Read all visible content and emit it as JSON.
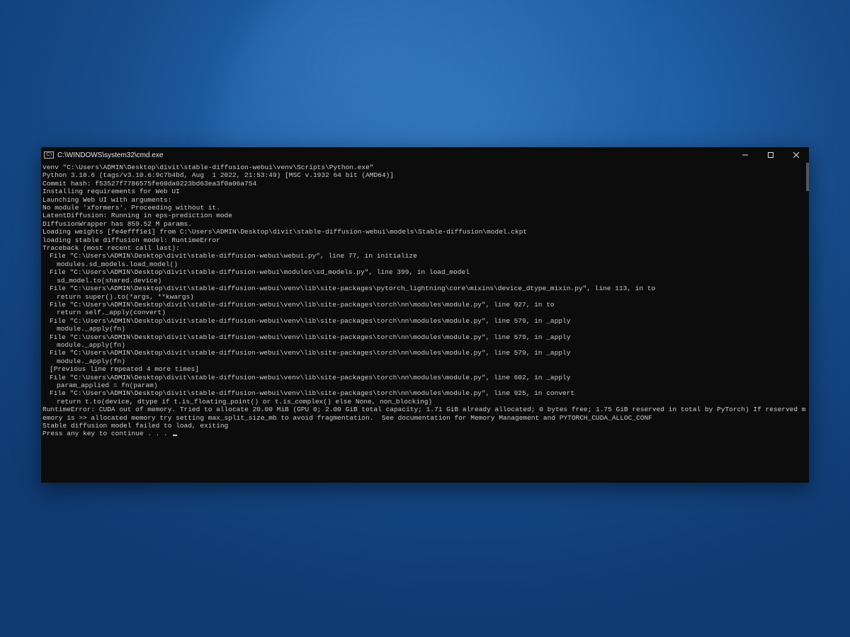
{
  "window": {
    "title": "C:\\WINDOWS\\system32\\cmd.exe",
    "icon_label": "C:\\"
  },
  "controls": {
    "minimize": "Minimize",
    "maximize": "Maximize",
    "close": "Close"
  },
  "console": {
    "lines": [
      {
        "cls": "",
        "text": "venv \"C:\\Users\\ADMIN\\Desktop\\divit\\stable-diffusion-webui\\venv\\Scripts\\Python.exe\""
      },
      {
        "cls": "",
        "text": "Python 3.10.6 (tags/v3.10.6:9c7b4bd, Aug  1 2022, 21:53:49) [MSC v.1932 64 bit (AMD64)]"
      },
      {
        "cls": "",
        "text": "Commit hash: f53527f7786575fe60da0223bd63ea3f0a06a754"
      },
      {
        "cls": "",
        "text": "Installing requirements for Web UI"
      },
      {
        "cls": "",
        "text": "Launching Web UI with arguments:"
      },
      {
        "cls": "",
        "text": "No module 'xformers'. Proceeding without it."
      },
      {
        "cls": "",
        "text": "LatentDiffusion: Running in eps-prediction mode"
      },
      {
        "cls": "",
        "text": "DiffusionWrapper has 859.52 M params."
      },
      {
        "cls": "",
        "text": "Loading weights [fe4efff1e1] from C:\\Users\\ADMIN\\Desktop\\divit\\stable-diffusion-webui\\models\\Stable-diffusion\\model.ckpt"
      },
      {
        "cls": "",
        "text": "loading stable diffusion model: RuntimeError"
      },
      {
        "cls": "",
        "text": "Traceback (most recent call last):"
      },
      {
        "cls": "ind1",
        "text": "File \"C:\\Users\\ADMIN\\Desktop\\divit\\stable-diffusion-webui\\webui.py\", line 77, in initialize"
      },
      {
        "cls": "ind2",
        "text": "modules.sd_models.load_model()"
      },
      {
        "cls": "ind1",
        "text": "File \"C:\\Users\\ADMIN\\Desktop\\divit\\stable-diffusion-webui\\modules\\sd_models.py\", line 399, in load_model"
      },
      {
        "cls": "ind2",
        "text": "sd_model.to(shared.device)"
      },
      {
        "cls": "ind1",
        "text": "File \"C:\\Users\\ADMIN\\Desktop\\divit\\stable-diffusion-webui\\venv\\lib\\site-packages\\pytorch_lightning\\core\\mixins\\device_dtype_mixin.py\", line 113, in to"
      },
      {
        "cls": "ind2",
        "text": "return super().to(*args, **kwargs)"
      },
      {
        "cls": "ind1",
        "text": "File \"C:\\Users\\ADMIN\\Desktop\\divit\\stable-diffusion-webui\\venv\\lib\\site-packages\\torch\\nn\\modules\\module.py\", line 927, in to"
      },
      {
        "cls": "ind2",
        "text": "return self._apply(convert)"
      },
      {
        "cls": "ind1",
        "text": "File \"C:\\Users\\ADMIN\\Desktop\\divit\\stable-diffusion-webui\\venv\\lib\\site-packages\\torch\\nn\\modules\\module.py\", line 579, in _apply"
      },
      {
        "cls": "ind2",
        "text": "module._apply(fn)"
      },
      {
        "cls": "ind1",
        "text": "File \"C:\\Users\\ADMIN\\Desktop\\divit\\stable-diffusion-webui\\venv\\lib\\site-packages\\torch\\nn\\modules\\module.py\", line 579, in _apply"
      },
      {
        "cls": "ind2",
        "text": "module._apply(fn)"
      },
      {
        "cls": "ind1",
        "text": "File \"C:\\Users\\ADMIN\\Desktop\\divit\\stable-diffusion-webui\\venv\\lib\\site-packages\\torch\\nn\\modules\\module.py\", line 579, in _apply"
      },
      {
        "cls": "ind2",
        "text": "module._apply(fn)"
      },
      {
        "cls": "ind1",
        "text": "[Previous line repeated 4 more times]"
      },
      {
        "cls": "ind1",
        "text": "File \"C:\\Users\\ADMIN\\Desktop\\divit\\stable-diffusion-webui\\venv\\lib\\site-packages\\torch\\nn\\modules\\module.py\", line 602, in _apply"
      },
      {
        "cls": "ind2",
        "text": "param_applied = fn(param)"
      },
      {
        "cls": "ind1",
        "text": "File \"C:\\Users\\ADMIN\\Desktop\\divit\\stable-diffusion-webui\\venv\\lib\\site-packages\\torch\\nn\\modules\\module.py\", line 925, in convert"
      },
      {
        "cls": "ind2",
        "text": "return t.to(device, dtype if t.is_floating_point() or t.is_complex() else None, non_blocking)"
      },
      {
        "cls": "",
        "text": "RuntimeError: CUDA out of memory. Tried to allocate 20.00 MiB (GPU 0; 2.00 GiB total capacity; 1.71 GiB already allocated; 0 bytes free; 1.75 GiB reserved in total by PyTorch) If reserved memory is >> allocated memory try setting max_split_size_mb to avoid fragmentation.  See documentation for Memory Management and PYTORCH_CUDA_ALLOC_CONF"
      },
      {
        "cls": "",
        "text": ""
      },
      {
        "cls": "",
        "text": ""
      },
      {
        "cls": "",
        "text": "Stable diffusion model failed to load, exiting"
      }
    ],
    "prompt": "Press any key to continue . . . "
  }
}
